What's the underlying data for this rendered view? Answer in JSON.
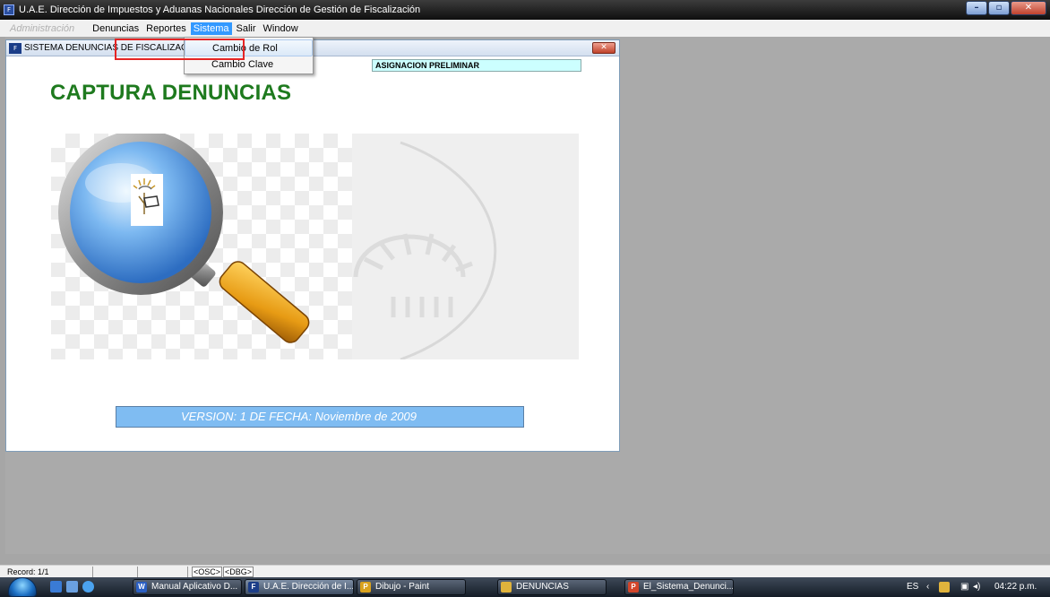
{
  "app": {
    "title": "U.A.E. Dirección de Impuestos y Aduanas Nacionales  Dirección de Gestión de Fiscalización"
  },
  "menu": {
    "items": [
      {
        "label": "Administración",
        "state": "disabled"
      },
      {
        "label": "Denuncias"
      },
      {
        "label": "Reportes"
      },
      {
        "label": "Sistema",
        "state": "active"
      },
      {
        "label": "Salir"
      },
      {
        "label": "Window"
      }
    ]
  },
  "dropdown": {
    "items": [
      "Cambio de Rol",
      "Cambio Clave"
    ],
    "highlighted": "Cambio de Rol"
  },
  "child": {
    "title": "SISTEMA DENUNCIAS DE FISCALIZACIO",
    "field_label": "ASIGNACION PRELIMINAR",
    "heading": "CAPTURA DENUNCIAS",
    "version": "VERSION:  1 DE FECHA:  Noviembre de 2009"
  },
  "statusbar": {
    "record": "Record: 1/1",
    "osc": "<OSC>",
    "dbg": "<DBG>"
  },
  "taskbar": {
    "items": [
      {
        "label": "Manual Aplicativo D...",
        "icon": "word-icon",
        "color": "#2b5fc2"
      },
      {
        "label": "U.A.E. Dirección de I...",
        "icon": "forms-icon",
        "color": "#1b3d88",
        "active": true
      },
      {
        "label": "Dibujo - Paint",
        "icon": "paint-icon",
        "color": "#d9a21e"
      },
      {
        "label": "DENUNCIAS",
        "icon": "folder-icon",
        "color": "#e0b33c"
      },
      {
        "label": "El_Sistema_Denunci...",
        "icon": "powerpoint-icon",
        "color": "#d2452a"
      }
    ],
    "tray": {
      "lang": "ES",
      "time": "04:22 p.m."
    }
  },
  "colors": {
    "heading": "#1e7a1e",
    "version_bar": "#7fbcf2",
    "field_bg": "#ccffff",
    "highlight": "#e52525"
  }
}
